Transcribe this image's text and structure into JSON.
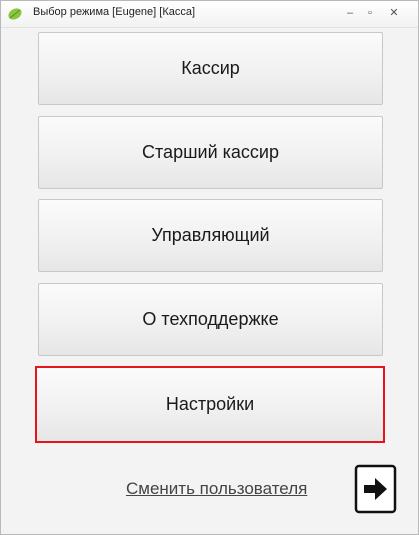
{
  "window": {
    "title": "Выбор режима [Eugene] [Касса]",
    "controls": {
      "minimize": "‒",
      "maximize": "▫",
      "close": "✕"
    }
  },
  "modes": [
    {
      "label": "Кассир"
    },
    {
      "label": "Старший кассир"
    },
    {
      "label": "Управляющий"
    },
    {
      "label": "О техподдержке"
    },
    {
      "label": "Настройки"
    }
  ],
  "footer": {
    "switch_user": "Сменить пользователя"
  },
  "colors": {
    "highlight_border": "#e8141c",
    "window_bg": "#f3f3f3"
  },
  "icons": {
    "app": "leaf-icon",
    "logout": "logout-arrow-icon"
  }
}
